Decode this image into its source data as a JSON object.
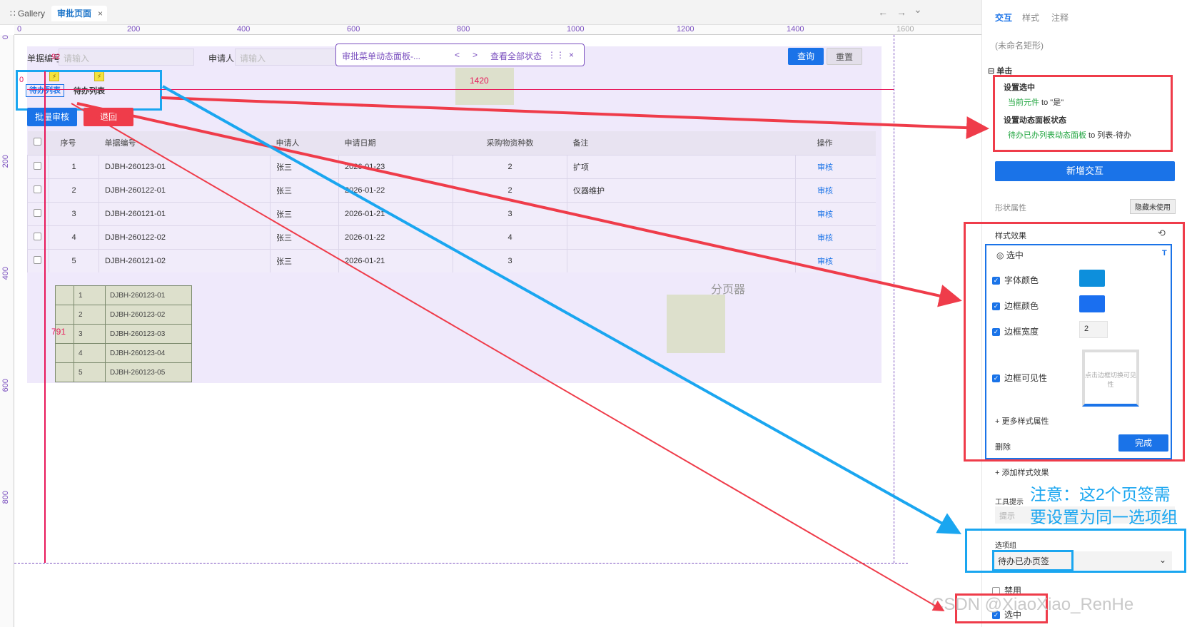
{
  "tabs": {
    "gallery": "Gallery",
    "active": "审批页面",
    "close": "×"
  },
  "nav": {
    "back": "←",
    "forward": "→",
    "menu": "⌄"
  },
  "ruler": {
    "top": [
      "0",
      "200",
      "400",
      "600",
      "800",
      "1000",
      "1200",
      "1400",
      "1600"
    ],
    "left": [
      "0",
      "200",
      "400",
      "600",
      "800"
    ]
  },
  "filters": {
    "doc_label": "单据编号:",
    "doc_placeholder": "请输入",
    "applicant_label": "申请人:",
    "applicant_placeholder": "请输入",
    "query": "查询",
    "reset": "重置"
  },
  "dynamic_panel": {
    "name": "审批菜单动态面板-...",
    "prev": "<",
    "next": ">",
    "view_all": "查看全部状态",
    "close": "×"
  },
  "canvas_labels": {
    "w1420": "1420",
    "h791": "791",
    "dim_w": "92",
    "zero": "0"
  },
  "todo_tabs": [
    "待办列表",
    "待办列表"
  ],
  "actions": {
    "batch": "批量审核",
    "back": "退回"
  },
  "table": {
    "headers": [
      "",
      "序号",
      "单据编号",
      "申请人",
      "申请日期",
      "采购物资种数",
      "备注",
      "操作"
    ],
    "rows": [
      [
        "1",
        "DJBH-260123-01",
        "张三",
        "2026-01-23",
        "2",
        "扩项",
        "审核"
      ],
      [
        "2",
        "DJBH-260122-01",
        "张三",
        "2026-01-22",
        "2",
        "仪器维护",
        "审核"
      ],
      [
        "3",
        "DJBH-260121-01",
        "张三",
        "2026-01-21",
        "3",
        "",
        "审核"
      ],
      [
        "4",
        "DJBH-260122-02",
        "张三",
        "2026-01-22",
        "4",
        "",
        "审核"
      ],
      [
        "5",
        "DJBH-260121-02",
        "张三",
        "2026-01-21",
        "3",
        "",
        "审核"
      ]
    ]
  },
  "pager": "分页器",
  "mini_list": [
    [
      "1",
      "DJBH-260123-01"
    ],
    [
      "2",
      "DJBH-260123-02"
    ],
    [
      "3",
      "DJBH-260123-03"
    ],
    [
      "4",
      "DJBH-260123-04"
    ],
    [
      "5",
      "DJBH-260123-05"
    ]
  ],
  "panel": {
    "tabs": {
      "interact": "交互",
      "style": "样式",
      "notes": "注释"
    },
    "shape_name": "(未命名矩形)",
    "event": "单击",
    "action1_title": "设置选中",
    "action1_detail_green": "当前元件",
    "action1_detail_rest": " to \"是\"",
    "action2_title": "设置动态面板状态",
    "action2_detail_green": "待办已办列表动态面板",
    "action2_detail_rest": " to 列表-待办",
    "new_interaction": "新增交互",
    "shape_props": "形状属性",
    "hide_unused": "隐藏未使用",
    "style_effects": "样式效果",
    "selected_state": "选中",
    "font_color": "字体颜色",
    "border_color": "边框颜色",
    "border_width": "边框宽度",
    "border_width_value": "2",
    "border_visible": "边框可见性",
    "border_toggle_hint": "点击边框切换可见性",
    "more_styles": "+ 更多样式属性",
    "delete": "删除",
    "done": "完成",
    "add_style_effect": "+ 添加样式效果",
    "tooltip_label": "工具提示",
    "tooltip_placeholder": "提示",
    "option_group_label": "选项组",
    "option_group_value": "待办已办页签",
    "disabled": "禁用",
    "selected": "选中",
    "colors": {
      "font": "#0d8fdc",
      "border": "#1a6ff0"
    }
  },
  "note": "注意：这2个页签需要设置为同一选项组",
  "watermark": "CSDN @XiaoXiao_RenHe"
}
